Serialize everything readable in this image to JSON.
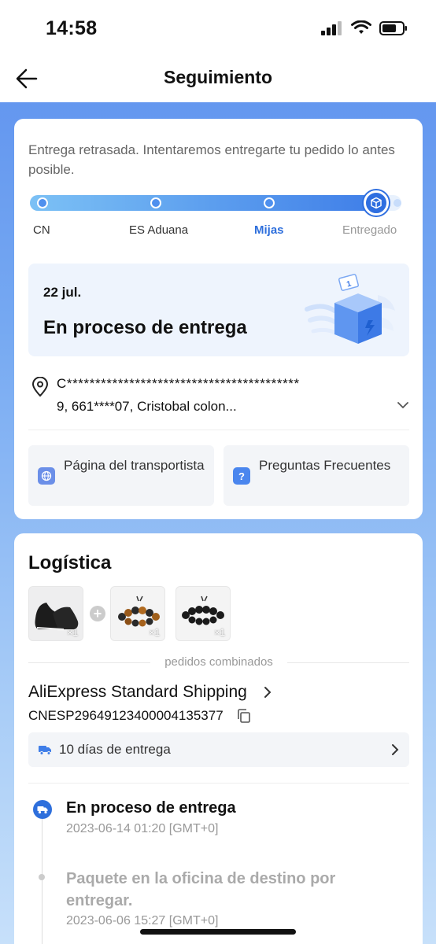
{
  "status_bar": {
    "time": "14:58"
  },
  "header": {
    "title": "Seguimiento"
  },
  "tracking_card": {
    "delay_message": "Entrega retrasada. Intentaremos entregarte tu pedido lo antes posible.",
    "stages": [
      "CN",
      "ES Aduana",
      "Mijas",
      "Entregado"
    ],
    "current_stage_index": 2,
    "status": {
      "date": "22 jul.",
      "label": "En proceso de entrega"
    },
    "address": {
      "line1": "C*****************************************",
      "line2": "9,  661****07,  Cristobal colon..."
    },
    "links": {
      "carrier_page": "Página del transportista",
      "faq": "Preguntas Frecuentes"
    }
  },
  "logistics": {
    "title": "Logística",
    "items": [
      {
        "name": "shoes",
        "qty": "×1"
      },
      {
        "name": "tiger-eye-bracelet",
        "qty": "×1"
      },
      {
        "name": "black-bead-bracelet",
        "qty": "×1"
      }
    ],
    "combined_label": "pedidos combinados",
    "carrier": "AliExpress Standard Shipping",
    "tracking_number": "CNESP29649123400004135377",
    "delivery_days": "10 días de entrega",
    "events": [
      {
        "title": "En proceso de entrega",
        "time": "2023-06-14 01:20 [GMT+0]"
      },
      {
        "title": "Paquete en la oficina de destino por entregar.",
        "time": "2023-06-06 15:27 [GMT+0]"
      }
    ]
  },
  "colors": {
    "accent": "#2e6fdc",
    "background_top": "#5c8fee",
    "background_bottom": "#c7e0fa"
  }
}
